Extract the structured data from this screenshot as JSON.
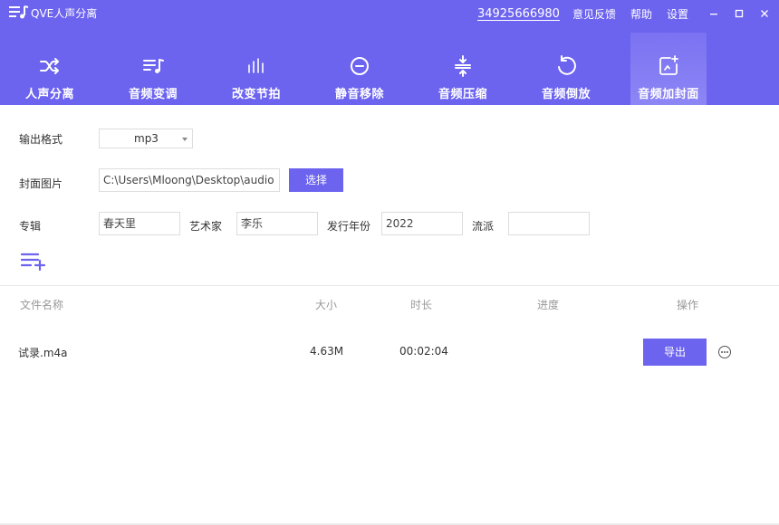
{
  "titlebar": {
    "app_title": "QVE人声分离",
    "phone": "34925666980",
    "feedback": "意见反馈",
    "help": "帮助",
    "settings": "设置"
  },
  "tabs": [
    {
      "label": "人声分离",
      "icon": "shuffle-icon",
      "active": false
    },
    {
      "label": "音频变调",
      "icon": "music-list-icon",
      "active": false
    },
    {
      "label": "改变节拍",
      "icon": "equalizer-icon",
      "active": false
    },
    {
      "label": "静音移除",
      "icon": "minus-circle-icon",
      "active": false
    },
    {
      "label": "音频压缩",
      "icon": "compress-icon",
      "active": false
    },
    {
      "label": "音频倒放",
      "icon": "rotate-ccw-icon",
      "active": false
    },
    {
      "label": "音频加封面",
      "icon": "image-plus-icon",
      "active": true
    }
  ],
  "form": {
    "format_label": "输出格式",
    "format_value": "mp3",
    "cover_label": "封面图片",
    "cover_path": "C:\\Users\\Mloong\\Desktop\\audio",
    "choose_button": "选择",
    "album_label": "专辑",
    "album_value": "春天里",
    "artist_label": "艺术家",
    "artist_value": "李乐",
    "year_label": "发行年份",
    "year_value": "2022",
    "genre_label": "流派",
    "genre_value": ""
  },
  "table": {
    "headers": {
      "name": "文件名称",
      "size": "大小",
      "duration": "时长",
      "progress": "进度",
      "action": "操作"
    },
    "rows": [
      {
        "name": "试录.m4a",
        "size": "4.63M",
        "duration": "00:02:04",
        "progress": "",
        "action": "导出"
      }
    ]
  },
  "colors": {
    "accent": "#6c63ef",
    "active_tab": "#8a83f4"
  }
}
